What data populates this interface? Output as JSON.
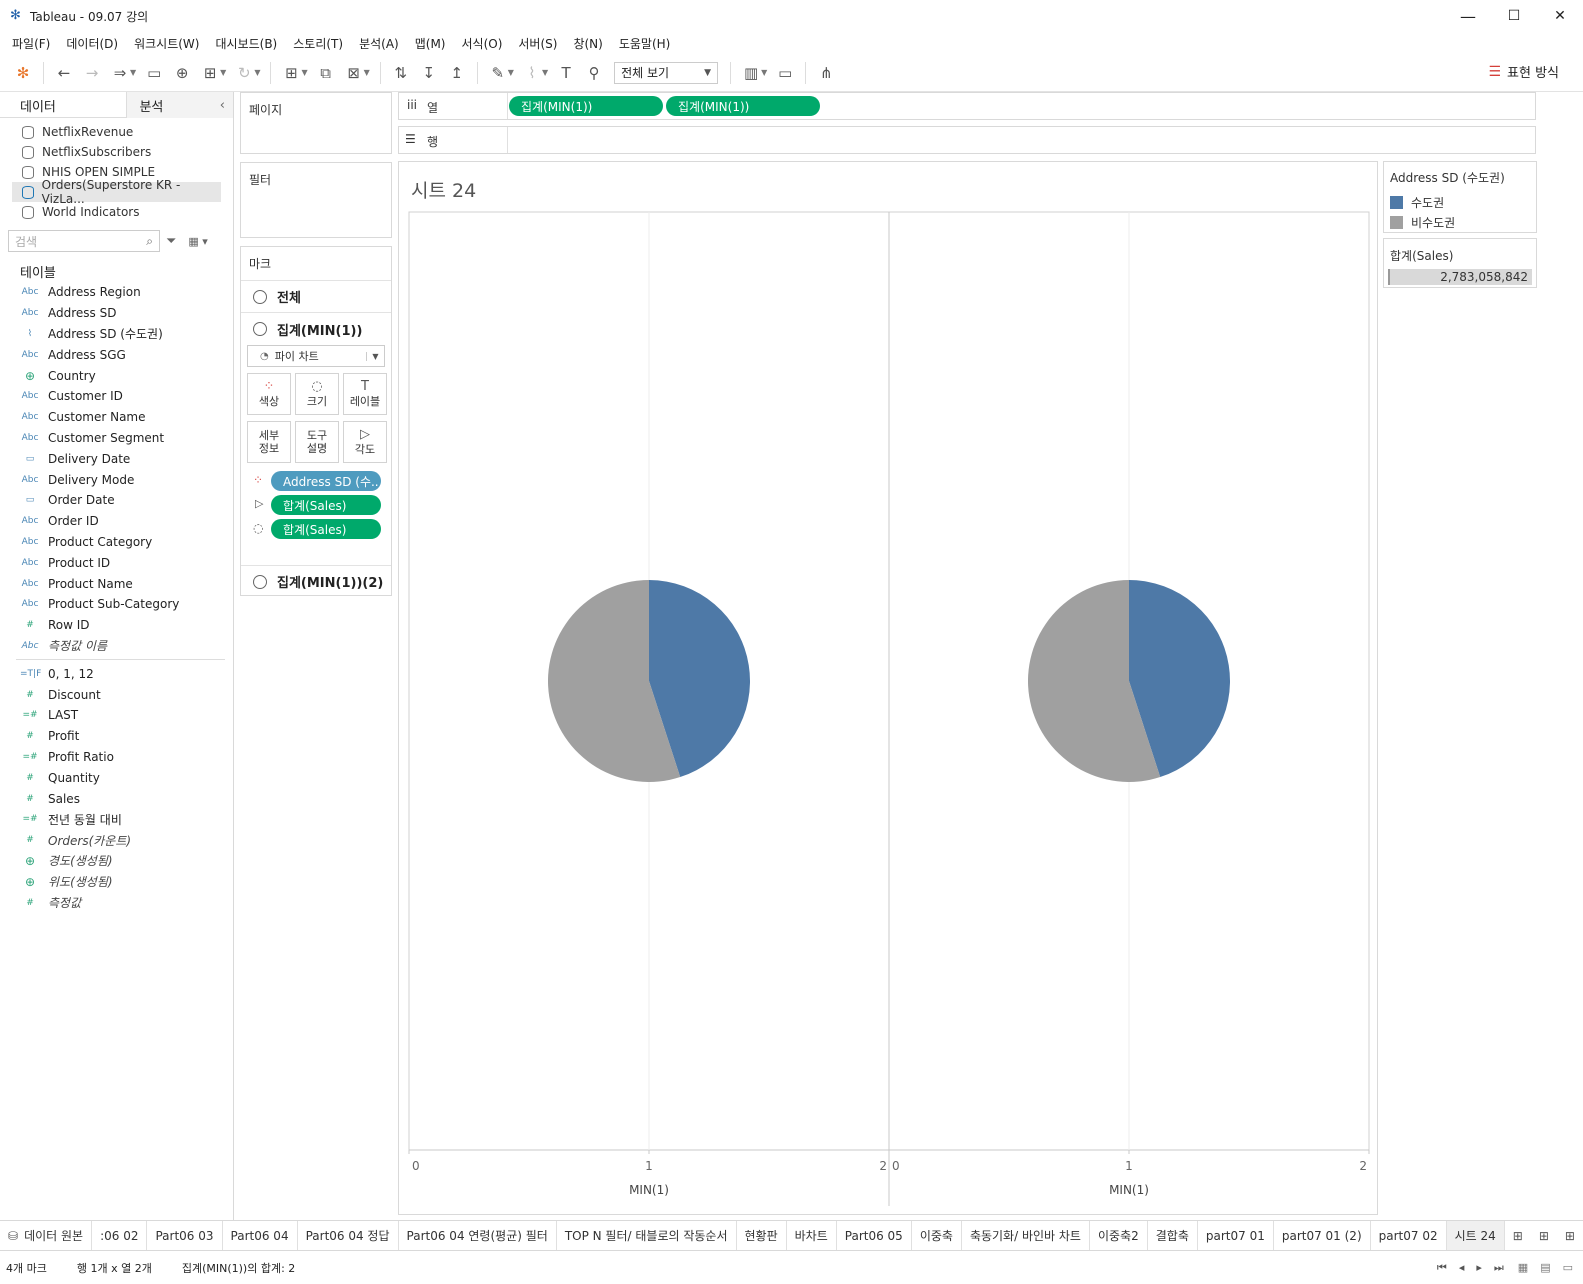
{
  "window": {
    "title": "Tableau - 09.07 강의",
    "minimize": "—",
    "maximize": "☐",
    "close": "✕"
  },
  "menu": [
    "파일(F)",
    "데이터(D)",
    "워크시트(W)",
    "대시보드(B)",
    "스토리(T)",
    "분석(A)",
    "맵(M)",
    "서식(O)",
    "서버(S)",
    "창(N)",
    "도움말(H)"
  ],
  "toolbar": {
    "fit_label": "전체 보기",
    "show_me_label": "표현 방식"
  },
  "data_pane": {
    "tab_data": "데이터",
    "tab_analysis": "분석",
    "datasources": [
      "NetflixRevenue",
      "NetflixSubscribers",
      "NHIS OPEN SIMPLE",
      "Orders(Superstore KR - VizLa...",
      "World Indicators"
    ],
    "search_placeholder": "검색",
    "tables_header": "테이블",
    "dimensions": [
      {
        "type": "Abc",
        "name": "Address Region"
      },
      {
        "type": "Abc",
        "name": "Address SD"
      },
      {
        "type": "clip",
        "name": "Address SD (수도권)"
      },
      {
        "type": "Abc",
        "name": "Address SGG"
      },
      {
        "type": "geo",
        "name": "Country"
      },
      {
        "type": "Abc",
        "name": "Customer ID"
      },
      {
        "type": "Abc",
        "name": "Customer Name"
      },
      {
        "type": "Abc",
        "name": "Customer Segment"
      },
      {
        "type": "date",
        "name": "Delivery Date"
      },
      {
        "type": "Abc",
        "name": "Delivery Mode"
      },
      {
        "type": "date",
        "name": "Order Date"
      },
      {
        "type": "Abc",
        "name": "Order ID"
      },
      {
        "type": "Abc",
        "name": "Product Category"
      },
      {
        "type": "Abc",
        "name": "Product ID"
      },
      {
        "type": "Abc",
        "name": "Product Name"
      },
      {
        "type": "Abc",
        "name": "Product Sub-Category"
      },
      {
        "type": "#",
        "name": "Row ID"
      },
      {
        "type": "Abc",
        "name": "측정값 이름",
        "italic": true
      }
    ],
    "measures": [
      {
        "type": "=T|F",
        "name": "0, 1, 12"
      },
      {
        "type": "#",
        "name": "Discount"
      },
      {
        "type": "=#",
        "name": "LAST"
      },
      {
        "type": "#",
        "name": "Profit"
      },
      {
        "type": "=#",
        "name": "Profit Ratio"
      },
      {
        "type": "#",
        "name": "Quantity"
      },
      {
        "type": "#",
        "name": "Sales"
      },
      {
        "type": "=#",
        "name": "전년 동월 대비"
      },
      {
        "type": "#",
        "name": "Orders(카운트)",
        "italic": true
      },
      {
        "type": "geo",
        "name": "경도(생성됨)",
        "italic": true
      },
      {
        "type": "geo",
        "name": "위도(생성됨)",
        "italic": true
      },
      {
        "type": "#",
        "name": "측정값",
        "italic": true
      }
    ]
  },
  "shelves": {
    "pages_label": "페이지",
    "filters_label": "필터",
    "columns_label": "열",
    "rows_label": "행",
    "column_pills": [
      "집계(MIN(1))",
      "집계(MIN(1))"
    ]
  },
  "marks": {
    "title": "마크",
    "all_label": "전체",
    "card1_label": "집계(MIN(1))",
    "card2_label": "집계(MIN(1))(2)",
    "mark_type": "파이 차트",
    "buttons": {
      "color": "색상",
      "size": "크기",
      "label": "레이블",
      "detail": "세부\n정보",
      "tooltip": "도구\n설명",
      "angle": "각도"
    },
    "pills": [
      "Address SD (수..",
      "합계(Sales)",
      "합계(Sales)"
    ]
  },
  "sheet": {
    "title": "시트 24"
  },
  "legend": {
    "title": "Address SD (수도권)",
    "items": [
      {
        "label": "수도권",
        "color": "#4e79a7"
      },
      {
        "label": "비수도권",
        "color": "#a0a0a0"
      }
    ]
  },
  "size_legend": {
    "title": "합계(Sales)",
    "value": "2,783,058,842"
  },
  "chart_data": {
    "type": "pie",
    "panes": [
      {
        "slices": [
          {
            "label": "수도권",
            "share": 0.45,
            "color": "#4e79a7"
          },
          {
            "label": "비수도권",
            "share": 0.55,
            "color": "#a0a0a0"
          }
        ],
        "x": 1
      },
      {
        "slices": [
          {
            "label": "수도권",
            "share": 0.45,
            "color": "#4e79a7"
          },
          {
            "label": "비수도권",
            "share": 0.55,
            "color": "#a0a0a0"
          }
        ],
        "x": 1
      }
    ],
    "axes": [
      {
        "ticks": [
          "0",
          "1",
          "2"
        ],
        "xlabel": "MIN(1)",
        "xlim": [
          0,
          2
        ]
      },
      {
        "ticks": [
          "0",
          "1",
          "2"
        ],
        "xlabel": "MIN(1)",
        "xlim": [
          0,
          2
        ]
      }
    ]
  },
  "sheet_tabs": [
    "데이터 원본",
    ":06 02",
    "Part06 03",
    "Part06 04",
    "Part06 04 정답",
    "Part06 04 연령(평균) 필터",
    "TOP N 필터/ 태블로의 작동순서",
    "현황판",
    "바차트",
    "Part06 05",
    "이중축",
    "축동기화/ 바인바 차트",
    "이중축2",
    "결합축",
    "part07 01",
    "part07 01 (2)",
    "part07 02",
    "시트 24"
  ],
  "status": {
    "marks": "4개 마크",
    "grid": "행 1개 x 열 2개",
    "sum": "집계(MIN(1))의 합계: 2"
  }
}
